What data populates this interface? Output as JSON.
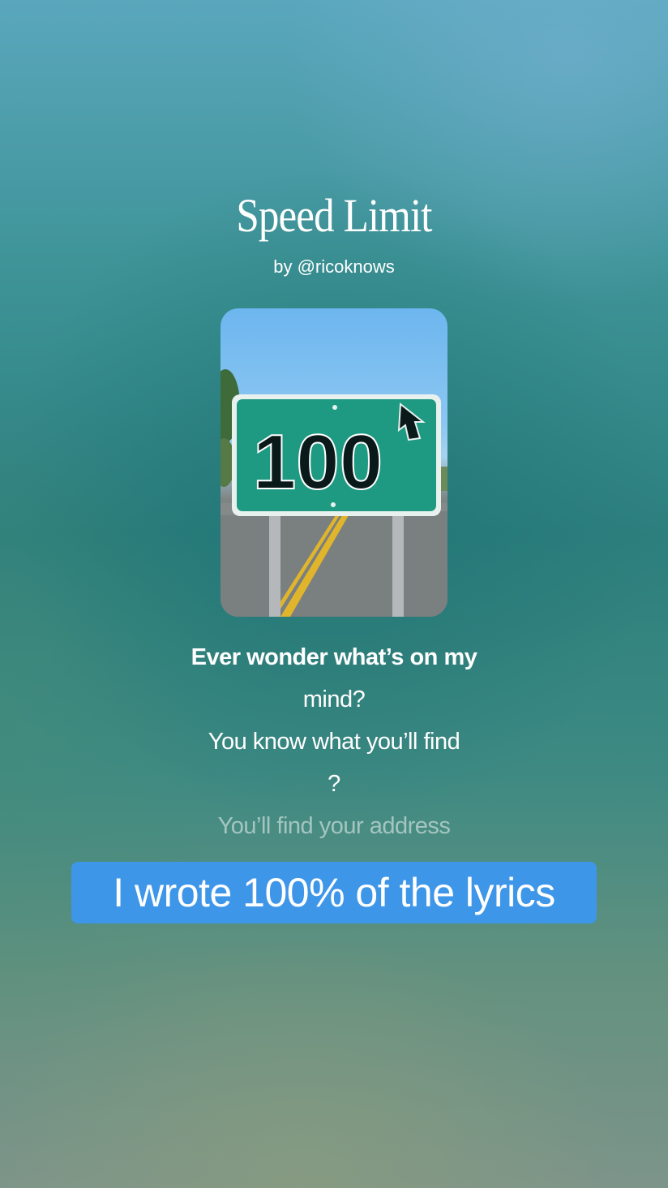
{
  "song": {
    "title": "Speed Limit",
    "byline": "by @ricoknows"
  },
  "artwork": {
    "sign_text": "100",
    "icon": "arrow-up-right-icon"
  },
  "lyrics": [
    "Ever wonder what’s on my",
    "mind?",
    "You know what you’ll find",
    "?",
    "You’ll find your address"
  ],
  "caption": "I wrote 100% of the lyrics",
  "colors": {
    "caption_background": "#3e96e8",
    "sign_green": "#1e9a82"
  }
}
